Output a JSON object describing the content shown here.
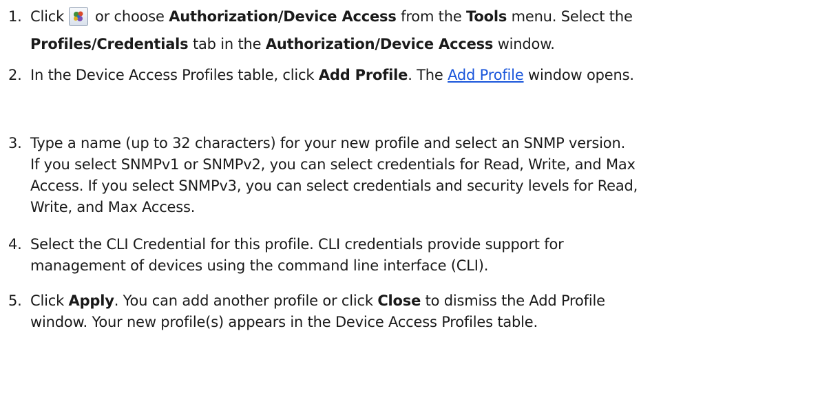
{
  "steps": [
    {
      "number": "1.",
      "lines": [
        [
          "Click ",
          "[icon]",
          " or choose ",
          "Authorization/Device Access",
          " from the ",
          "Tools",
          " menu. Select the"
        ],
        [
          "Profiles/Credentials",
          " tab in the ",
          "Authorization/Device Access",
          " window."
        ]
      ],
      "icon": "authorization-device-access-icon"
    },
    {
      "number": "2.",
      "lines": [
        [
          "In the Device Access Profiles table, click ",
          "Add Profile",
          ". The ",
          "Add Profile",
          " window opens."
        ]
      ]
    },
    {
      "number": "3.",
      "lines": [
        [
          "Type a name (up to 32 characters) for your new profile and select an SNMP version."
        ],
        [
          "If you select SNMPv1 or SNMPv2, you can select credentials for Read, Write, and Max"
        ],
        [
          "Access. If you select SNMPv3, you can select credentials and security levels for Read,"
        ],
        [
          "Write, and Max Access."
        ]
      ]
    },
    {
      "number": "4.",
      "lines": [
        [
          "Select the CLI Credential for this profile. CLI credentials provide support for"
        ],
        [
          "management of devices using the command line interface (CLI)."
        ]
      ]
    },
    {
      "number": "5.",
      "lines": [
        [
          "Click ",
          "Apply",
          ". You can add another profile or click ",
          "Close",
          " to dismiss the Add Profile"
        ],
        [
          "window. Your new profile(s) appears in the Device Access Profiles table."
        ]
      ]
    }
  ]
}
